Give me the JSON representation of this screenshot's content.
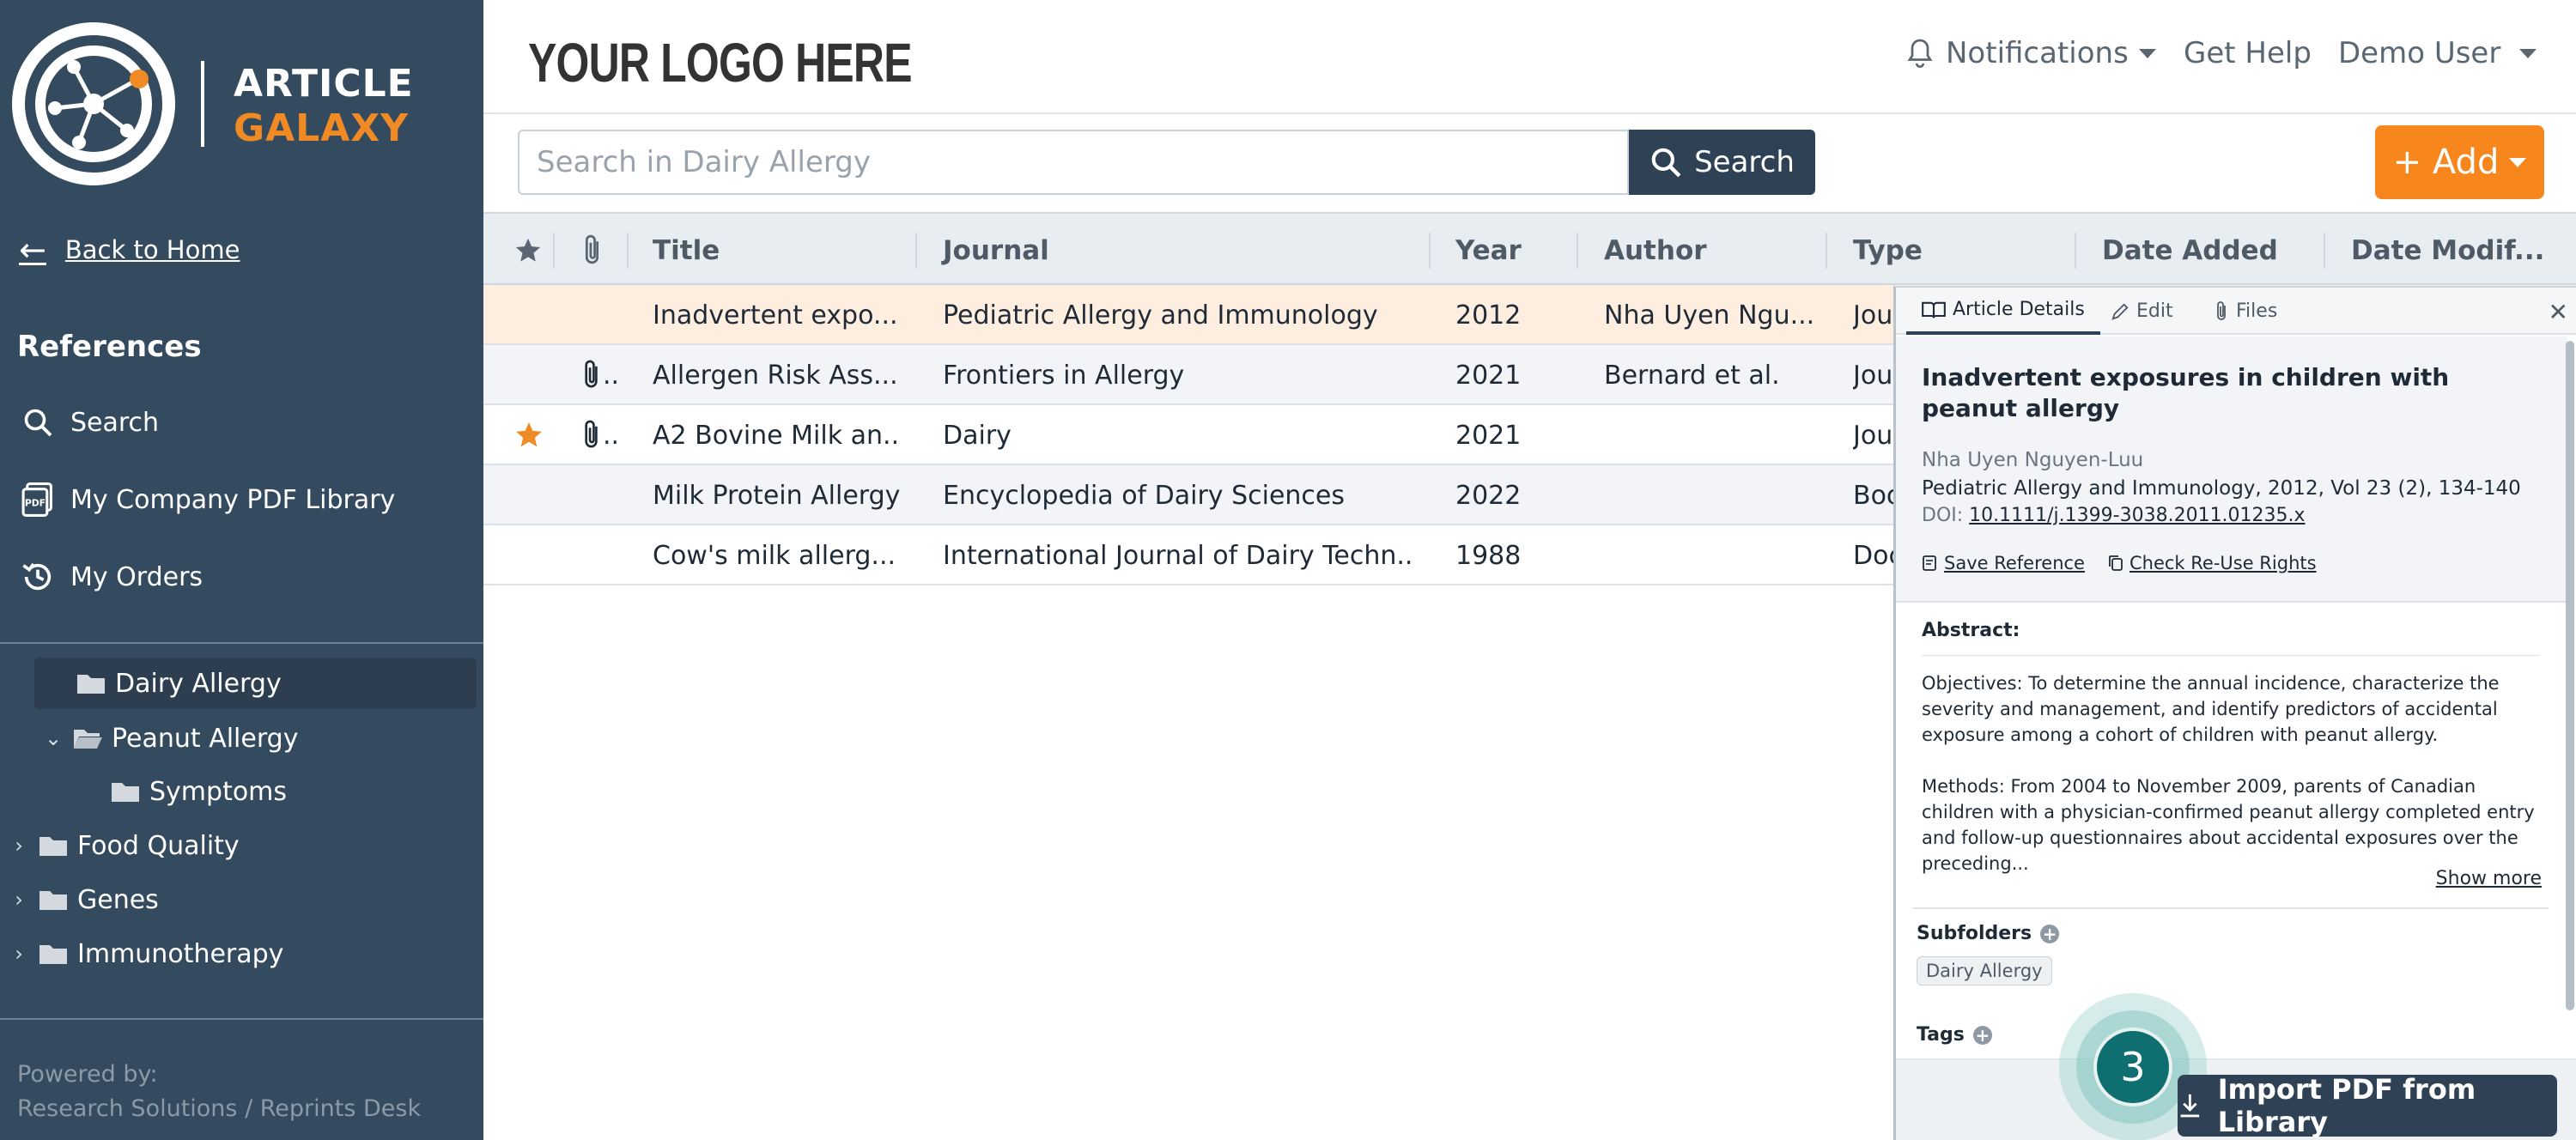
{
  "logo": {
    "word1": "ARTICLE",
    "word2": "GALAXY"
  },
  "sidebar": {
    "back_label": "Back to Home",
    "heading": "References",
    "nav": [
      {
        "label": "Search",
        "icon": "search-icon"
      },
      {
        "label": "My Company PDF Library",
        "icon": "pdf-icon"
      },
      {
        "label": "My Orders",
        "icon": "history-icon"
      }
    ],
    "folders": [
      {
        "label": "Dairy Allergy",
        "active": true
      },
      {
        "label": "Peanut Allergy",
        "expanded": true
      },
      {
        "label": "Symptoms"
      },
      {
        "label": "Food Quality"
      },
      {
        "label": "Genes"
      },
      {
        "label": "Immunotherapy"
      }
    ],
    "powered_line1": "Powered by:",
    "powered_line2": "Research Solutions / Reprints Desk"
  },
  "header": {
    "brand": "YOUR LOGO HERE",
    "notifications": "Notifications",
    "help": "Get Help",
    "user": "Demo User"
  },
  "search": {
    "placeholder": "Search in Dairy Allergy",
    "button": "Search",
    "add_button": "+ Add"
  },
  "table": {
    "columns": [
      "Title",
      "Journal",
      "Year",
      "Author",
      "Type",
      "Date Added",
      "Date Modif..."
    ],
    "rows": [
      {
        "title": "Inadvertent expo...",
        "journal": "Pediatric Allergy and Immunology",
        "year": "2012",
        "author": "Nha Uyen Ngu...",
        "type": "Jou",
        "starred": false,
        "attachment": false
      },
      {
        "title": "Allergen Risk Ass...",
        "journal": "Frontiers in Allergy",
        "year": "2021",
        "author": "Bernard et al.",
        "type": "Jou",
        "starred": false,
        "attachment": true
      },
      {
        "title": "A2 Bovine Milk an...",
        "journal": "Dairy",
        "year": "2021",
        "author": "",
        "type": "Jou",
        "starred": true,
        "attachment": true
      },
      {
        "title": "Milk Protein Allergy",
        "journal": "Encyclopedia of Dairy Sciences",
        "year": "2022",
        "author": "",
        "type": "Boo",
        "starred": false,
        "attachment": false
      },
      {
        "title": "Cow's milk allerg...",
        "journal": "International Journal of Dairy Techn...",
        "year": "1988",
        "author": "",
        "type": "Doc",
        "starred": false,
        "attachment": false
      }
    ],
    "attach_suffix": "..",
    "accent": "#f08a24"
  },
  "panel": {
    "tabs": [
      "Article Details",
      "Edit",
      "Files"
    ],
    "title": "Inadvertent exposures in children with peanut allergy",
    "author": "Nha Uyen Nguyen-Luu",
    "journal_line": "Pediatric Allergy and Immunology, 2012, Vol 23 (2), 134-140",
    "doi_label": "DOI:",
    "doi": "10.1111/j.1399-3038.2011.01235.x",
    "save_reference": "Save Reference",
    "check_rights": "Check Re-Use Rights",
    "abstract_label": "Abstract:",
    "abstract_p1": "Objectives: To determine the annual incidence, characterize the severity and management, and identify predictors of accidental exposure among a cohort of children with peanut allergy.",
    "abstract_p2": "Methods: From 2004 to November 2009, parents of Canadian children with a physician-confirmed peanut allergy completed entry and follow-up questionnaires about accidental exposures over the preceding...",
    "show_more": "Show more",
    "subfolders_label": "Subfolders",
    "subfolder_chip": "Dairy Allergy",
    "tags_label": "Tags"
  },
  "badge_count": "3",
  "import_button": "Import PDF from Library"
}
